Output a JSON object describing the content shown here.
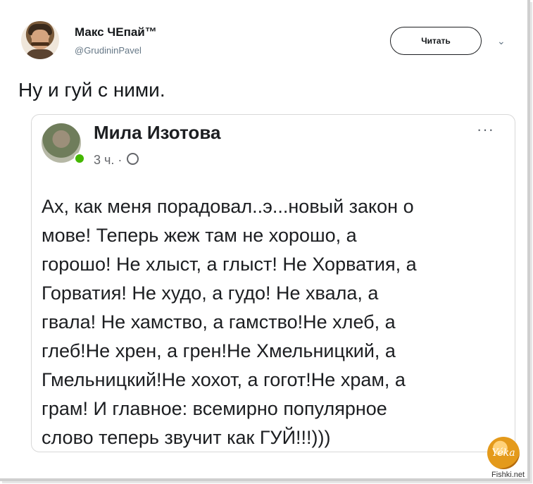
{
  "tweet": {
    "author_name": "Макс ЧЕпай™",
    "author_handle": "@GrudininPavel",
    "follow_label": "Читать",
    "chevron_icon": "chevron-down-icon",
    "text": "Ну и гуй с ними."
  },
  "embedded_post": {
    "author_name": "Мила Изотова",
    "time": "3 ч. ·",
    "privacy_icon": "globe-icon",
    "more_label": "···",
    "text": "Ах, как меня порадовал..э...новый закон о\nмове! Теперь жеж там не хорошо, а\nгорошо! Не хлыст, а глыст! Не Хорватия, а\nГорватия! Не худо, а гудо! Не хвала, а\nгвала! Не хамство, а гамство!Не хлеб, а\nглеб!Не хрен, а грен!Не Хмельницкий, а\nГмельницкий!Не хохот, а гогот!Не храм, а\nграм! И главное: всемирно популярное\nслово теперь звучит как ГУЙ!!!)))"
  },
  "watermark": {
    "logo_text": "Yéka",
    "site": "Fishki.net"
  },
  "colors": {
    "text": "#1c1e21",
    "muted": "#65676b",
    "online": "#44b700"
  }
}
